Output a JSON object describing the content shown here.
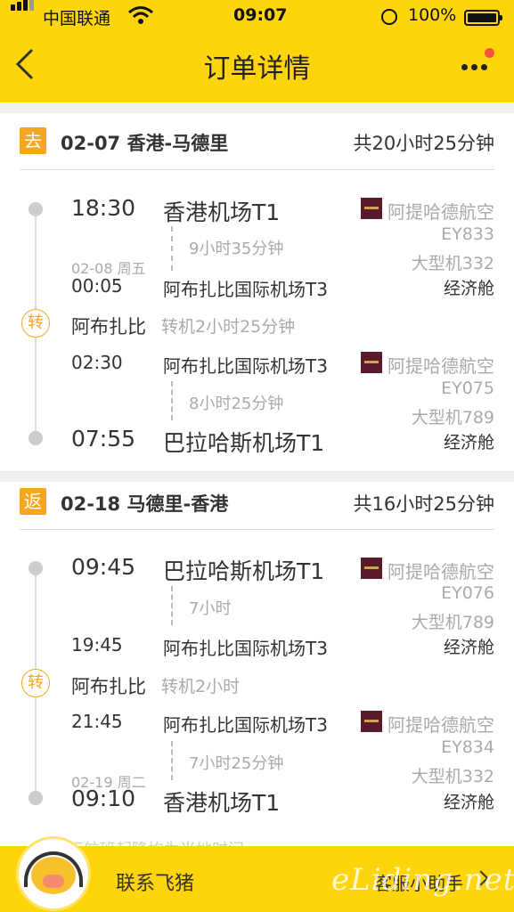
{
  "status_bar": {
    "carrier": "中国联通",
    "time": "09:07",
    "battery": "100%"
  },
  "header": {
    "title": "订单详情",
    "back_icon": "chevron-left-icon",
    "more_icon": "more-dots-icon"
  },
  "colors": {
    "brand": "#fed40a",
    "accent": "#f5a623",
    "badge_dot": "#f2553e"
  },
  "outbound": {
    "badge": "去",
    "route": "02-07 香港-马德里",
    "total": "共20小时25分钟",
    "legs": [
      {
        "dep_time": "18:30",
        "dep_airport": "香港机场T1",
        "duration": "9小时35分钟",
        "arr_date_note": "02-08 周五",
        "arr_time": "00:05",
        "arr_airport": "阿布扎比国际机场T3",
        "airline": "阿提哈德航空",
        "flight": "EY833",
        "aircraft": "大型机332",
        "cabin": "经济舱"
      },
      {
        "dep_time": "02:30",
        "dep_airport": "阿布扎比国际机场T3",
        "duration": "8小时25分钟",
        "arr_date_note": "",
        "arr_time": "07:55",
        "arr_airport": "巴拉哈斯机场T1",
        "airline": "阿提哈德航空",
        "flight": "EY075",
        "aircraft": "大型机789",
        "cabin": "经济舱"
      }
    ],
    "transfer": {
      "icon": "转",
      "city": "阿布扎比",
      "layover": "转机2小时25分钟"
    }
  },
  "return": {
    "badge": "返",
    "route": "02-18 马德里-香港",
    "total": "共16小时25分钟",
    "legs": [
      {
        "dep_time": "09:45",
        "dep_airport": "巴拉哈斯机场T1",
        "duration": "7小时",
        "arr_date_note": "",
        "arr_time": "19:45",
        "arr_airport": "阿布扎比国际机场T3",
        "airline": "阿提哈德航空",
        "flight": "EY076",
        "aircraft": "大型机789",
        "cabin": "经济舱"
      },
      {
        "dep_time": "21:45",
        "dep_airport": "阿布扎比国际机场T3",
        "duration": "7小时25分钟",
        "arr_date_note": "02-19 周二",
        "arr_time": "09:10",
        "arr_airport": "香港机场T1",
        "airline": "阿提哈德航空",
        "flight": "EY834",
        "aircraft": "大型机332",
        "cabin": "经济舱"
      }
    ],
    "transfer": {
      "icon": "转",
      "city": "阿布扎比",
      "layover": "转机2小时"
    }
  },
  "footer": {
    "note": "国际航班起降均为当地时间",
    "contact": "联系飞猪",
    "assistant": "客服小助手",
    "watermark": "eLiding.net"
  }
}
